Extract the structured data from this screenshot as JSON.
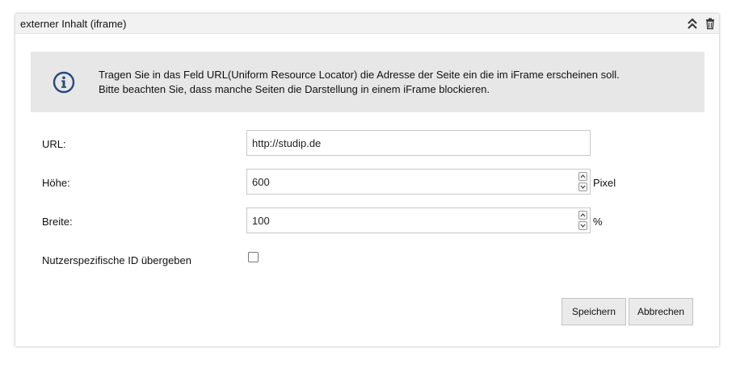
{
  "panel": {
    "title": "externer Inhalt (iframe)",
    "icons": [
      "double-chevron-up-icon",
      "trash-icon"
    ]
  },
  "info": {
    "icon": "info-icon",
    "line1": "Tragen Sie in das Feld URL(Uniform Resource Locator) die Adresse der Seite ein die im iFrame erscheinen soll.",
    "line2": "Bitte beachten Sie, dass manche Seiten die Darstellung in einem iFrame blockieren."
  },
  "form": {
    "url": {
      "label": "URL:",
      "value": "http://studip.de"
    },
    "height": {
      "label": "Höhe:",
      "value": "600",
      "unit": "Pixel"
    },
    "width": {
      "label": "Breite:",
      "value": "100",
      "unit": "%"
    },
    "user_id": {
      "label": "Nutzerspezifische ID übergeben",
      "checked": false
    }
  },
  "buttons": {
    "save": "Speichern",
    "cancel": "Abbrechen"
  },
  "colors": {
    "info_icon": "#28497c",
    "header_bg": "#f2f2f2",
    "info_bg": "#e7e7e7",
    "button_bg": "#eaeaea"
  }
}
